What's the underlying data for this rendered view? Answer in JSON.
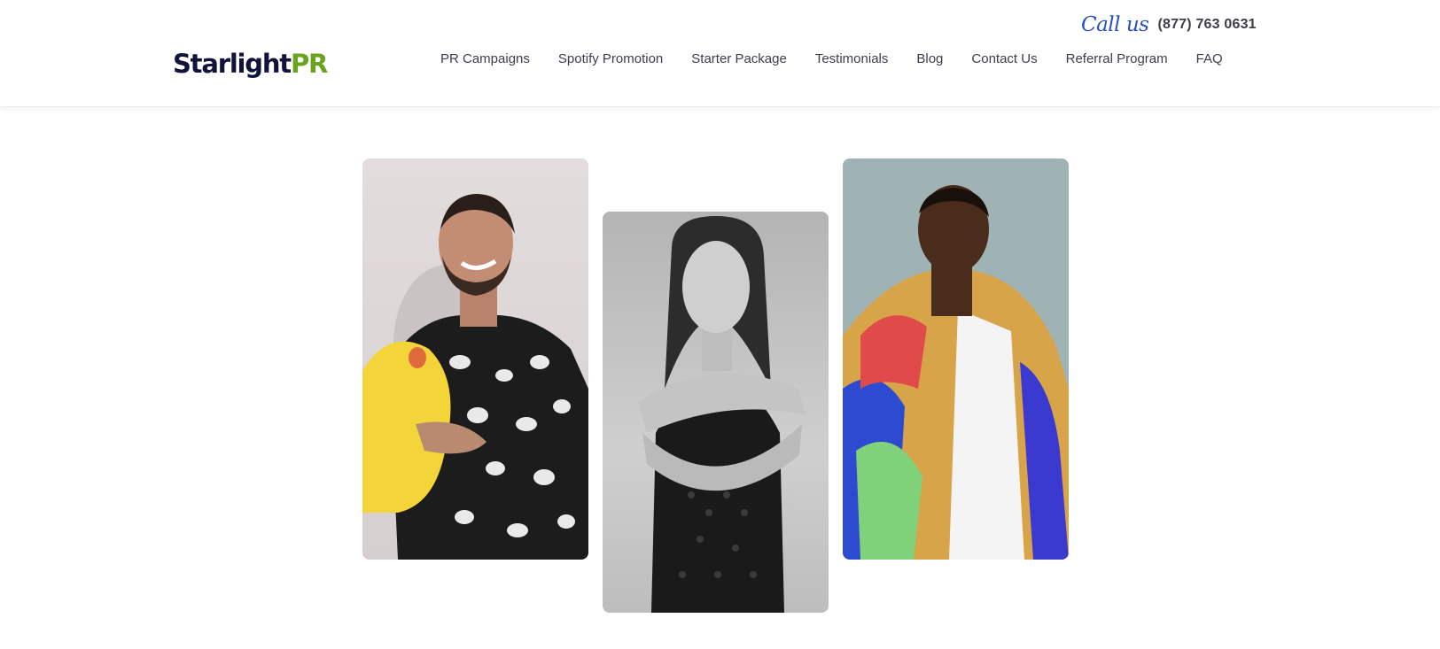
{
  "header": {
    "logo": {
      "main": "Starlight",
      "accent": "PR"
    },
    "call": {
      "label": "Call us",
      "phone": "(877) 763 0631"
    },
    "nav": [
      {
        "label": "PR Campaigns"
      },
      {
        "label": "Spotify Promotion"
      },
      {
        "label": "Starter Package"
      },
      {
        "label": "Testimonials"
      },
      {
        "label": "Blog"
      },
      {
        "label": "Contact Us"
      },
      {
        "label": "Referral Program"
      },
      {
        "label": "FAQ"
      }
    ]
  },
  "colors": {
    "brand_dark": "#11133a",
    "brand_accent": "#6aa320",
    "call_script": "#2a4fc4",
    "nav_text": "#3a3f4a"
  },
  "gallery": {
    "items": [
      {
        "photo": "artist-photo-tattooed-man-with-plush-toy"
      },
      {
        "photo": "artist-photo-woman-black-and-white"
      },
      {
        "photo": "artist-photo-man-colorful-jacket"
      }
    ]
  }
}
